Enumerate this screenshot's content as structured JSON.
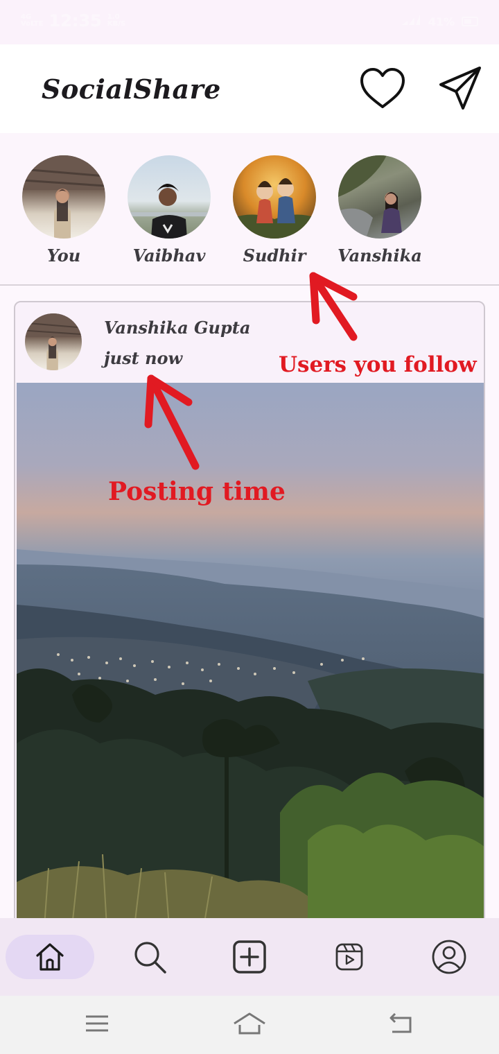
{
  "status_bar": {
    "network_small_top": "4G",
    "network_small_bottom": "VoLTE",
    "time": "12:35",
    "net_speed_top": "1.0",
    "net_speed_bottom": "KB/S",
    "battery": "41%"
  },
  "app_bar": {
    "title": "SocialShare",
    "icons": [
      "heart-icon",
      "send-icon"
    ]
  },
  "stories": [
    {
      "name": "You"
    },
    {
      "name": "Vaibhav"
    },
    {
      "name": "Sudhir"
    },
    {
      "name": "Vanshika"
    }
  ],
  "post": {
    "user_name": "Vanshika Gupta",
    "time": "just now"
  },
  "annotations": {
    "follow_label": "Users you follow",
    "time_label": "Posting time",
    "color": "#e11a22"
  },
  "bottom_nav": {
    "items": [
      "home-icon",
      "search-icon",
      "add-post-icon",
      "reels-icon",
      "profile-icon"
    ],
    "active": "home-icon"
  },
  "system_nav": [
    "menu-icon",
    "home-icon",
    "back-icon"
  ],
  "colors": {
    "background": "#fdf7fd",
    "accent": "#e4d8f3",
    "text": "#3d3b40"
  }
}
